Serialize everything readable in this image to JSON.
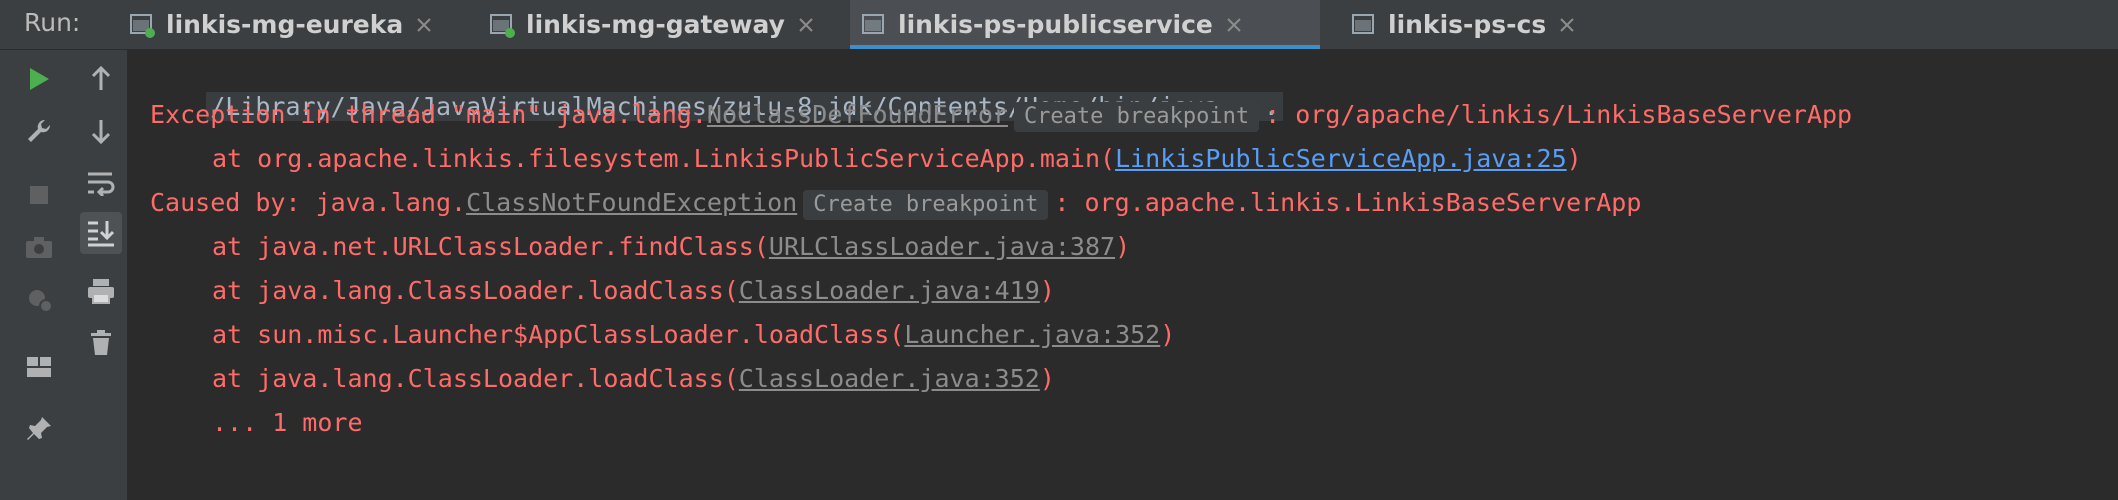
{
  "run_label": "Run:",
  "tabs": [
    {
      "label": "linkis-mg-eureka",
      "active": false
    },
    {
      "label": "linkis-mg-gateway",
      "active": false
    },
    {
      "label": "linkis-ps-publicservice",
      "active": true
    },
    {
      "label": "linkis-ps-cs",
      "active": false
    }
  ],
  "toolbar_left": [
    "run-icon",
    "wrench-icon",
    "stop-icon",
    "camera-icon",
    "debug-settings-icon",
    "layout-icon",
    "pin-icon"
  ],
  "toolbar_right": [
    "up-arrow-icon",
    "down-arrow-icon",
    "soft-wrap-icon",
    "scroll-to-end-icon",
    "print-icon",
    "trash-icon"
  ],
  "console": {
    "command": "/Library/Java/JavaVirtualMachines/zulu-8.jdk/Contents/Home/bin/java ...",
    "line1": {
      "prefix": "Exception in thread \"main\" java.lang.",
      "exception": "NoClassDefFoundError",
      "breakpoint": "Create breakpoint",
      "suffix": ": org/apache/linkis/LinkisBaseServerApp"
    },
    "line2": {
      "prefix": "at org.apache.linkis.filesystem.LinkisPublicServiceApp.main(",
      "link": "LinkisPublicServiceApp.java:25",
      "suffix": ")"
    },
    "line3": {
      "prefix": "Caused by: java.lang.",
      "exception": "ClassNotFoundException",
      "breakpoint": "Create breakpoint",
      "suffix": ": org.apache.linkis.LinkisBaseServerApp"
    },
    "stack": [
      {
        "prefix": "at java.net.URLClassLoader.findClass(",
        "link": "URLClassLoader.java:387",
        "suffix": ")"
      },
      {
        "prefix": "at java.lang.ClassLoader.loadClass(",
        "link": "ClassLoader.java:419",
        "suffix": ")"
      },
      {
        "prefix": "at sun.misc.Launcher$AppClassLoader.loadClass(",
        "link": "Launcher.java:352",
        "suffix": ")"
      },
      {
        "prefix": "at java.lang.ClassLoader.loadClass(",
        "link": "ClassLoader.java:352",
        "suffix": ")"
      }
    ],
    "more": "... 1 more"
  },
  "colors": {
    "error_text": "#ff6b68",
    "link_blue": "#589df6",
    "tab_accent": "#3d8ec9",
    "run_green": "#4caf50"
  }
}
